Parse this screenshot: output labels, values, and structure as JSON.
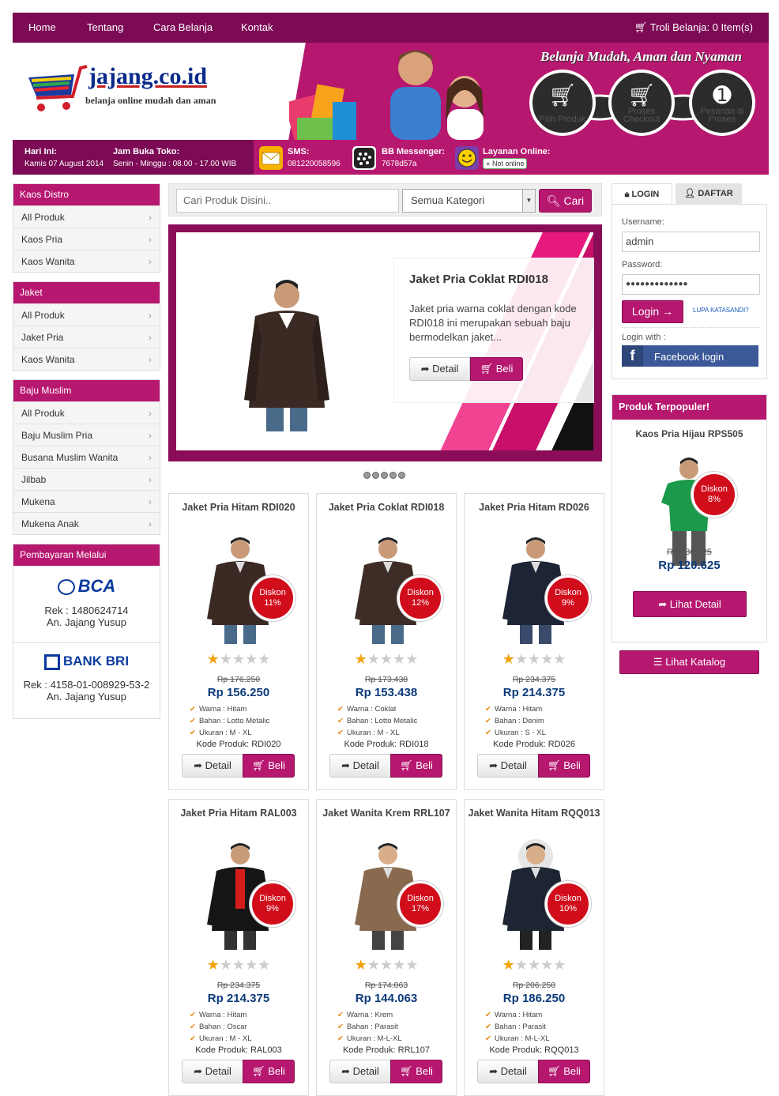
{
  "nav": {
    "items": [
      "Home",
      "Tentang",
      "Cara Belanja",
      "Kontak"
    ],
    "cart": "Troli Belanja: 0 Item(s)"
  },
  "header": {
    "logo": "jajang.co.id",
    "tagline": "belanja online mudah dan aman",
    "slogan": "Belanja Mudah, Aman dan Nyaman",
    "steps": [
      "Pilih Produk",
      "Proses Checkout",
      "Pesanan di Proses"
    ]
  },
  "info": {
    "today_label": "Hari Ini:",
    "today": "Kamis 07 August 2014",
    "hours_label": "Jam Buka Toko:",
    "hours": "Senin - Minggu : 08.00 - 17.00 WIB",
    "sms_label": "SMS:",
    "sms": "081220058596",
    "bbm_label": "BB Messenger:",
    "bbm": "7678d57a",
    "online_label": "Layanan Online:",
    "online_status": "Not online"
  },
  "sidebar": {
    "groups": [
      {
        "title": "Kaos Distro",
        "items": [
          "All Produk",
          "Kaos Pria",
          "Kaos Wanita"
        ]
      },
      {
        "title": "Jaket",
        "items": [
          "All Produk",
          "Jaket Pria",
          "Kaos Wanita"
        ]
      },
      {
        "title": "Baju Muslim",
        "items": [
          "All Produk",
          "Baju Muslim Pria",
          "Busana Muslim Wanita",
          "Jilbab",
          "Mukena",
          "Mukena Anak"
        ]
      }
    ],
    "payment": {
      "title": "Pembayaran Melalui",
      "banks": [
        {
          "name": "BCA",
          "rek": "Rek : 1480624714",
          "owner": "An. Jajang Yusup"
        },
        {
          "name": "BANK BRI",
          "rek": "Rek : 4158-01-008929-53-2",
          "owner": "An. Jajang Yusup"
        }
      ]
    }
  },
  "search": {
    "placeholder": "Cari Produk Disini..",
    "category": "Semua Kategori",
    "button": "Cari"
  },
  "slider": {
    "title": "Jaket Pria Coklat RDI018",
    "text": "Jaket pria warna coklat dengan kode RDI018 ini merupakan sebuah baju bermodelkan jaket...",
    "detail": "Detail",
    "buy": "Beli"
  },
  "products": [
    {
      "name": "Jaket Pria Hitam RDI020",
      "discount": "11%",
      "old": "Rp 176.250",
      "price": "Rp 156.250",
      "warna": "Warna : Hitam",
      "bahan": "Bahan : Lotto Metalic",
      "ukuran": "Ukuran : M - XL",
      "kode": "Kode Produk: RDI020",
      "rating": 1
    },
    {
      "name": "Jaket Pria Coklat RDI018",
      "discount": "12%",
      "old": "Rp 173.438",
      "price": "Rp 153.438",
      "warna": "Warna : Coklat",
      "bahan": "Bahan : Lotto Metalic",
      "ukuran": "Ukuran : M - XL",
      "kode": "Kode Produk: RDI018",
      "rating": 1
    },
    {
      "name": "Jaket Pria Hitam RD026",
      "discount": "9%",
      "old": "Rp 234.375",
      "price": "Rp 214.375",
      "warna": "Warna : Hitam",
      "bahan": "Bahan : Denim",
      "ukuran": "Ukuran : S - XL",
      "kode": "Kode Produk: RD026",
      "rating": 1
    },
    {
      "name": "Jaket Pria Hitam RAL003",
      "discount": "9%",
      "old": "Rp 234.375",
      "price": "Rp 214.375",
      "warna": "Warna : Hitam",
      "bahan": "Bahan : Oscar",
      "ukuran": "Ukuran : M - XL",
      "kode": "Kode Produk: RAL003",
      "rating": 1
    },
    {
      "name": "Jaket Wanita Krem RRL107",
      "discount": "17%",
      "old": "Rp 174.063",
      "price": "Rp 144.063",
      "warna": "Warna : Krem",
      "bahan": "Bahan : Parasit",
      "ukuran": "Ukuran : M-L-XL",
      "kode": "Kode Produk: RRL107",
      "rating": 1
    },
    {
      "name": "Jaket Wanita Hitam RQQ013",
      "discount": "10%",
      "old": "Rp 206.250",
      "price": "Rp 186.250",
      "warna": "Warna : Hitam",
      "bahan": "Bahan : Parasit",
      "ukuran": "Ukuran : M-L-XL",
      "kode": "Kode Produk: RQQ013",
      "rating": 1
    }
  ],
  "product_buttons": {
    "detail": "Detail",
    "buy": "Beli",
    "discount_label": "Diskon"
  },
  "login": {
    "tab_login": "LOGIN",
    "tab_register": "DAFTAR",
    "username_label": "Username:",
    "username": "admin",
    "password_label": "Password:",
    "password": "●●●●●●●●●●●●●",
    "button": "Login →",
    "forgot": "LUPA KATASANDI?",
    "login_with": "Login with :",
    "facebook": "Facebook login"
  },
  "popular": {
    "title": "Produk Terpopuler!",
    "name": "Kaos Pria Hijau RPS505",
    "discount": "8%",
    "old": "Rp 130.625",
    "price": "Rp 120.625",
    "button": "Lihat Detail"
  },
  "catalog_button": "Lihat Katalog",
  "colors": {
    "magenta": "#b6176f",
    "dark_magenta": "#7c0a55",
    "price_blue": "#0b3a7a",
    "badge_red": "#d10d1c"
  }
}
